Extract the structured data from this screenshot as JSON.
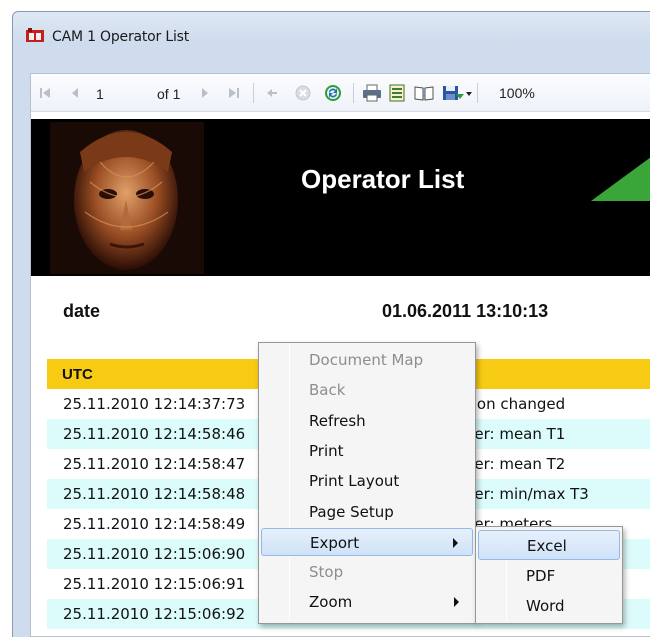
{
  "window": {
    "title": "CAM 1 Operator List"
  },
  "toolbar": {
    "page_value": "1",
    "of_label": "of 1",
    "zoom": "100%",
    "icons": [
      "first-page-icon",
      "previous-page-icon",
      "next-page-icon",
      "last-page-icon",
      "back-icon",
      "stop-icon",
      "refresh-icon",
      "print-icon",
      "print-layout-icon",
      "page-setup-icon",
      "export-icon"
    ]
  },
  "report": {
    "title": "Operator List",
    "date_label": "date",
    "date_value": "01.06.2011 13:10:13",
    "column_header": "UTC",
    "rows": [
      {
        "utc": "25.11.2010 12:14:37:73",
        "text": "uration changed"
      },
      {
        "utc": "25.11.2010 12:14:58:46",
        "text": "logger: mean T1"
      },
      {
        "utc": "25.11.2010 12:14:58:47",
        "text": "logger: mean T2"
      },
      {
        "utc": "25.11.2010 12:14:58:48",
        "text": "logger: min/max T3"
      },
      {
        "utc": "25.11.2010 12:14:58:49",
        "text": "logger: meters"
      },
      {
        "utc": "25.11.2010 12:15:06:90",
        "text": ""
      },
      {
        "utc": "25.11.2010 12:15:06:91",
        "text": ""
      },
      {
        "utc": "25.11.2010 12:15:06:92",
        "text": ""
      }
    ]
  },
  "context_menu": {
    "items": [
      {
        "label": "Document Map",
        "enabled": false
      },
      {
        "label": "Back",
        "enabled": false
      },
      {
        "label": "Refresh",
        "enabled": true
      },
      {
        "label": "Print",
        "enabled": true
      },
      {
        "label": "Print Layout",
        "enabled": true
      },
      {
        "label": "Page Setup",
        "enabled": true
      },
      {
        "label": "Export",
        "enabled": true,
        "submenu": true,
        "highlighted": true
      },
      {
        "label": "Stop",
        "enabled": false
      },
      {
        "label": "Zoom",
        "enabled": true,
        "submenu": true
      }
    ]
  },
  "export_submenu": {
    "items": [
      {
        "label": "Excel",
        "highlighted": true
      },
      {
        "label": "PDF"
      },
      {
        "label": "Word"
      }
    ]
  },
  "colors": {
    "header_bar": "#f7cb14",
    "alt_row": "#dcfbfb",
    "banner_bg": "#000000",
    "accent_triangle": "#3aa63a"
  }
}
